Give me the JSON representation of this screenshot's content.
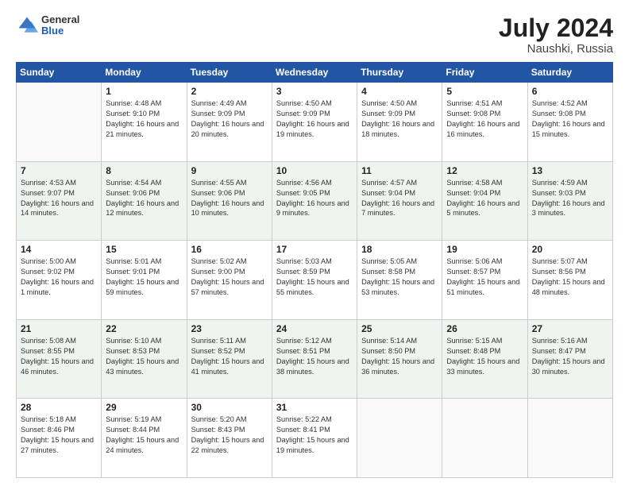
{
  "header": {
    "logo_general": "General",
    "logo_blue": "Blue",
    "month_year": "July 2024",
    "location": "Naushki, Russia"
  },
  "weekdays": [
    "Sunday",
    "Monday",
    "Tuesday",
    "Wednesday",
    "Thursday",
    "Friday",
    "Saturday"
  ],
  "weeks": [
    [
      {
        "day": "",
        "empty": true
      },
      {
        "day": "1",
        "sunrise": "4:48 AM",
        "sunset": "9:10 PM",
        "daylight": "16 hours and 21 minutes."
      },
      {
        "day": "2",
        "sunrise": "4:49 AM",
        "sunset": "9:09 PM",
        "daylight": "16 hours and 20 minutes."
      },
      {
        "day": "3",
        "sunrise": "4:50 AM",
        "sunset": "9:09 PM",
        "daylight": "16 hours and 19 minutes."
      },
      {
        "day": "4",
        "sunrise": "4:50 AM",
        "sunset": "9:09 PM",
        "daylight": "16 hours and 18 minutes."
      },
      {
        "day": "5",
        "sunrise": "4:51 AM",
        "sunset": "9:08 PM",
        "daylight": "16 hours and 16 minutes."
      },
      {
        "day": "6",
        "sunrise": "4:52 AM",
        "sunset": "9:08 PM",
        "daylight": "16 hours and 15 minutes."
      }
    ],
    [
      {
        "day": "7",
        "sunrise": "4:53 AM",
        "sunset": "9:07 PM",
        "daylight": "16 hours and 14 minutes."
      },
      {
        "day": "8",
        "sunrise": "4:54 AM",
        "sunset": "9:06 PM",
        "daylight": "16 hours and 12 minutes."
      },
      {
        "day": "9",
        "sunrise": "4:55 AM",
        "sunset": "9:06 PM",
        "daylight": "16 hours and 10 minutes."
      },
      {
        "day": "10",
        "sunrise": "4:56 AM",
        "sunset": "9:05 PM",
        "daylight": "16 hours and 9 minutes."
      },
      {
        "day": "11",
        "sunrise": "4:57 AM",
        "sunset": "9:04 PM",
        "daylight": "16 hours and 7 minutes."
      },
      {
        "day": "12",
        "sunrise": "4:58 AM",
        "sunset": "9:04 PM",
        "daylight": "16 hours and 5 minutes."
      },
      {
        "day": "13",
        "sunrise": "4:59 AM",
        "sunset": "9:03 PM",
        "daylight": "16 hours and 3 minutes."
      }
    ],
    [
      {
        "day": "14",
        "sunrise": "5:00 AM",
        "sunset": "9:02 PM",
        "daylight": "16 hours and 1 minute."
      },
      {
        "day": "15",
        "sunrise": "5:01 AM",
        "sunset": "9:01 PM",
        "daylight": "15 hours and 59 minutes."
      },
      {
        "day": "16",
        "sunrise": "5:02 AM",
        "sunset": "9:00 PM",
        "daylight": "15 hours and 57 minutes."
      },
      {
        "day": "17",
        "sunrise": "5:03 AM",
        "sunset": "8:59 PM",
        "daylight": "15 hours and 55 minutes."
      },
      {
        "day": "18",
        "sunrise": "5:05 AM",
        "sunset": "8:58 PM",
        "daylight": "15 hours and 53 minutes."
      },
      {
        "day": "19",
        "sunrise": "5:06 AM",
        "sunset": "8:57 PM",
        "daylight": "15 hours and 51 minutes."
      },
      {
        "day": "20",
        "sunrise": "5:07 AM",
        "sunset": "8:56 PM",
        "daylight": "15 hours and 48 minutes."
      }
    ],
    [
      {
        "day": "21",
        "sunrise": "5:08 AM",
        "sunset": "8:55 PM",
        "daylight": "15 hours and 46 minutes."
      },
      {
        "day": "22",
        "sunrise": "5:10 AM",
        "sunset": "8:53 PM",
        "daylight": "15 hours and 43 minutes."
      },
      {
        "day": "23",
        "sunrise": "5:11 AM",
        "sunset": "8:52 PM",
        "daylight": "15 hours and 41 minutes."
      },
      {
        "day": "24",
        "sunrise": "5:12 AM",
        "sunset": "8:51 PM",
        "daylight": "15 hours and 38 minutes."
      },
      {
        "day": "25",
        "sunrise": "5:14 AM",
        "sunset": "8:50 PM",
        "daylight": "15 hours and 36 minutes."
      },
      {
        "day": "26",
        "sunrise": "5:15 AM",
        "sunset": "8:48 PM",
        "daylight": "15 hours and 33 minutes."
      },
      {
        "day": "27",
        "sunrise": "5:16 AM",
        "sunset": "8:47 PM",
        "daylight": "15 hours and 30 minutes."
      }
    ],
    [
      {
        "day": "28",
        "sunrise": "5:18 AM",
        "sunset": "8:46 PM",
        "daylight": "15 hours and 27 minutes."
      },
      {
        "day": "29",
        "sunrise": "5:19 AM",
        "sunset": "8:44 PM",
        "daylight": "15 hours and 24 minutes."
      },
      {
        "day": "30",
        "sunrise": "5:20 AM",
        "sunset": "8:43 PM",
        "daylight": "15 hours and 22 minutes."
      },
      {
        "day": "31",
        "sunrise": "5:22 AM",
        "sunset": "8:41 PM",
        "daylight": "15 hours and 19 minutes."
      },
      {
        "day": "",
        "empty": true
      },
      {
        "day": "",
        "empty": true
      },
      {
        "day": "",
        "empty": true
      }
    ]
  ]
}
